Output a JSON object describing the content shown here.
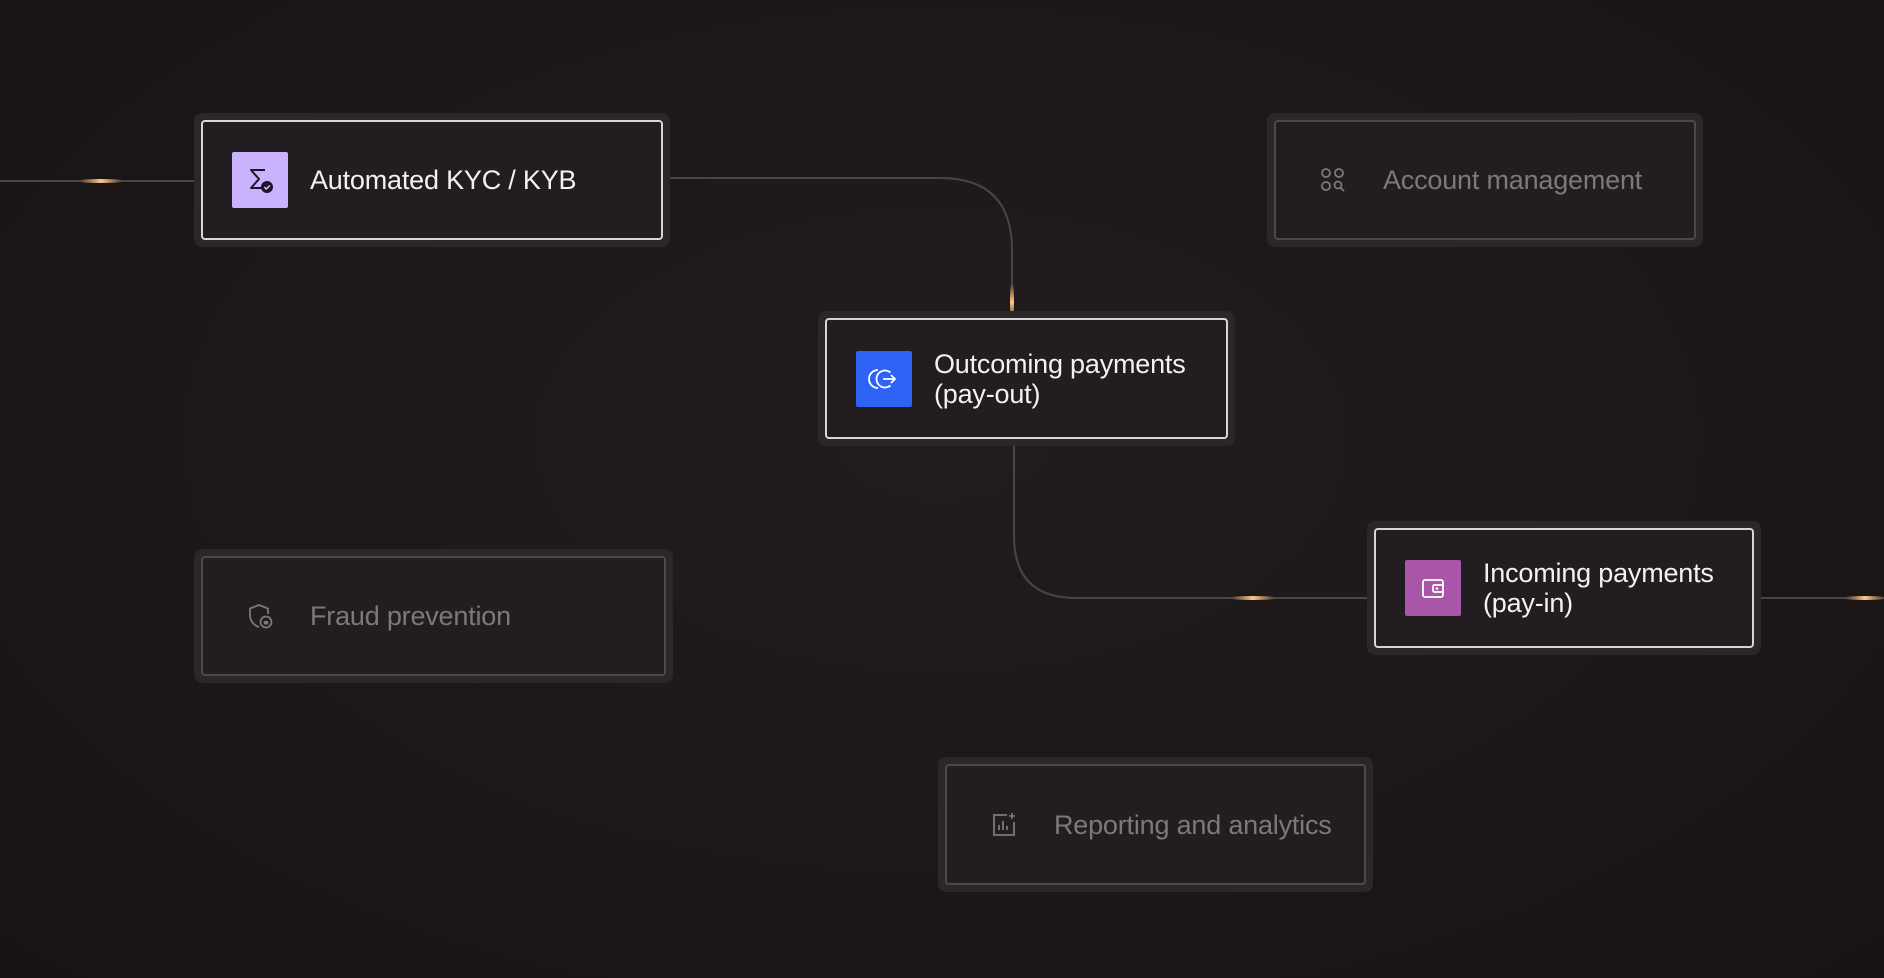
{
  "diagram": {
    "nodes": [
      {
        "id": "kyc",
        "label": "Automated KYC / KYB",
        "state": "active",
        "icon": "sigma-check-icon",
        "icon_color": "#c9b3ff"
      },
      {
        "id": "account",
        "label": "Account management",
        "state": "muted",
        "icon": "grid-search-icon"
      },
      {
        "id": "payout",
        "label": "Outcoming payments (pay-out)",
        "state": "active",
        "icon": "payout-arrow-icon",
        "icon_color": "#2e63f5"
      },
      {
        "id": "fraud",
        "label": "Fraud prevention",
        "state": "muted",
        "icon": "shield-lock-icon"
      },
      {
        "id": "payin",
        "label": "Incoming payments (pay-in)",
        "state": "active",
        "icon": "wallet-icon",
        "icon_color": "#a955a8"
      },
      {
        "id": "reporting",
        "label": "Reporting and analytics",
        "state": "muted",
        "icon": "chart-sparkle-icon"
      }
    ],
    "edges": [
      {
        "from": "input",
        "to": "kyc"
      },
      {
        "from": "kyc",
        "to": "payout"
      },
      {
        "from": "payout",
        "to": "payin"
      },
      {
        "from": "payin",
        "to": "output"
      }
    ],
    "colors": {
      "background": "#1c1819",
      "wire": "#4a4446",
      "glow": "#ffb36b",
      "active_border": "#d9d4d6",
      "muted_border": "#4e484b"
    }
  }
}
